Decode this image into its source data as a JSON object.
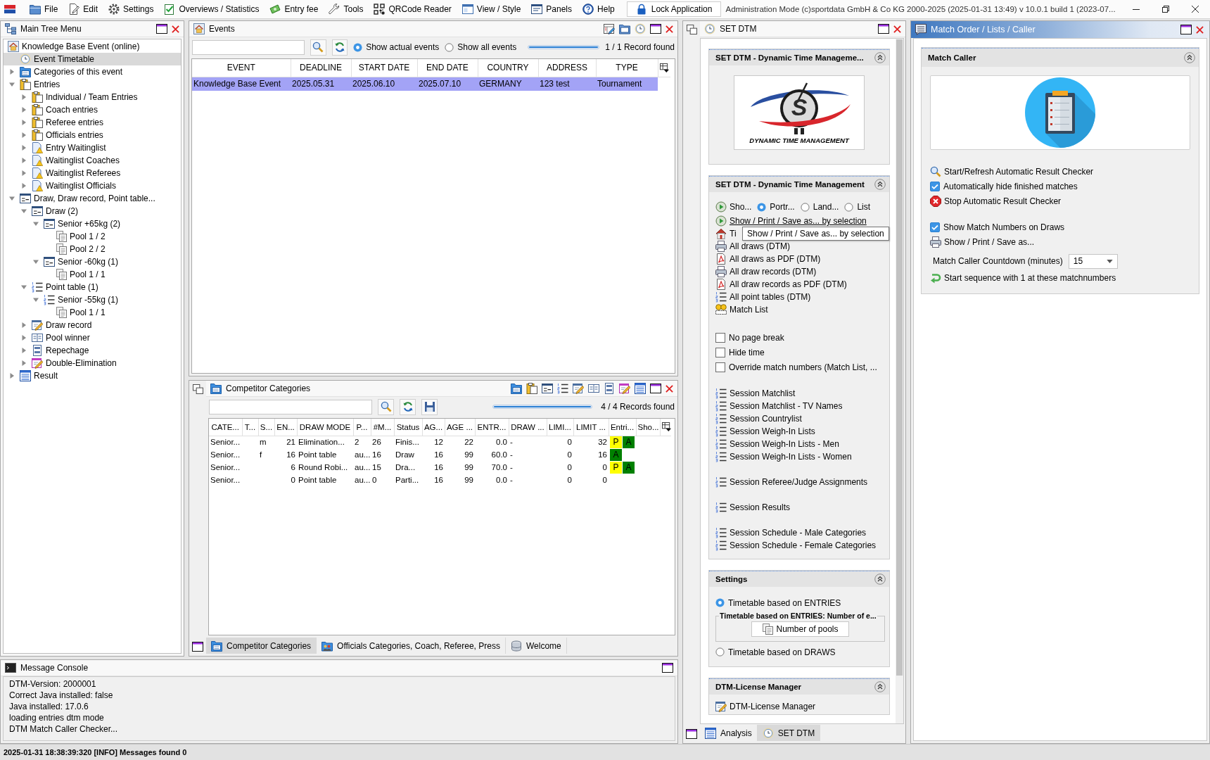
{
  "menu_bar": {
    "items": [
      "File",
      "Edit",
      "Settings",
      "Overviews / Statistics",
      "Entry fee",
      "Tools",
      "QRCode Reader",
      "View / Style",
      "Panels",
      "Help"
    ],
    "lock_button": "Lock Application",
    "title": "Administration Mode (c)sportdata GmbH & Co KG 2000-2025 (2025-01-31 13:49) v 10.0.1 build 1 (2023-07..."
  },
  "main_tree": {
    "title": "Main Tree Menu",
    "items": [
      {
        "label": "Knowledge Base Event (online)",
        "kind": "event",
        "selected": false,
        "children": [
          {
            "label": "Event Timetable",
            "kind": "timetable",
            "selected": true
          },
          {
            "label": "Categories of this event",
            "kind": "categories",
            "selected": false,
            "expanded": false
          },
          {
            "label": "Entries",
            "kind": "entries",
            "selected": false,
            "expanded": true,
            "children": [
              {
                "label": "Individual / Team Entries",
                "kind": "entries",
                "selected": false,
                "expanded": false
              },
              {
                "label": "Coach entries",
                "kind": "entries",
                "selected": false,
                "expanded": false
              },
              {
                "label": "Referee entries",
                "kind": "entries",
                "selected": false,
                "expanded": false
              },
              {
                "label": "Officials entries",
                "kind": "entries",
                "selected": false,
                "expanded": false
              },
              {
                "label": "Entry Waitinglist",
                "kind": "waitinglist",
                "selected": false,
                "expanded": false
              },
              {
                "label": "Waitinglist Coaches",
                "kind": "waitinglist",
                "selected": false,
                "expanded": false
              },
              {
                "label": "Waitinglist Referees",
                "kind": "waitinglist",
                "selected": false,
                "expanded": false
              },
              {
                "label": "Waitinglist Officials",
                "kind": "waitinglist",
                "selected": false,
                "expanded": false
              }
            ]
          },
          {
            "label": "Draw, Draw record, Point table...",
            "kind": "draw",
            "selected": false,
            "expanded": true,
            "children": [
              {
                "label": "Draw (2)",
                "kind": "draw",
                "selected": false,
                "expanded": true,
                "children": [
                  {
                    "label": "Senior +65kg (2)",
                    "kind": "draw",
                    "selected": false,
                    "expanded": true,
                    "children": [
                      {
                        "label": "Pool 1 / 2",
                        "kind": "pool",
                        "selected": false
                      },
                      {
                        "label": "Pool 2 / 2",
                        "kind": "pool",
                        "selected": false
                      }
                    ]
                  },
                  {
                    "label": "Senior -60kg (1)",
                    "kind": "draw",
                    "selected": false,
                    "expanded": true,
                    "children": [
                      {
                        "label": "Pool 1 / 1",
                        "kind": "pool",
                        "selected": false
                      }
                    ]
                  }
                ]
              },
              {
                "label": "Point table (1)",
                "kind": "point-table",
                "selected": false,
                "expanded": true,
                "children": [
                  {
                    "label": "Senior -55kg (1)",
                    "kind": "point-table",
                    "selected": false,
                    "expanded": true,
                    "children": [
                      {
                        "label": "Pool 1 / 1",
                        "kind": "pool",
                        "selected": false
                      }
                    ]
                  }
                ]
              },
              {
                "label": "Draw record",
                "kind": "draw-record",
                "selected": false,
                "expanded": false
              },
              {
                "label": "Pool winner",
                "kind": "pool-winner",
                "selected": false,
                "expanded": false
              },
              {
                "label": "Repechage",
                "kind": "repechage",
                "selected": false,
                "expanded": false
              },
              {
                "label": "Double-Elimination",
                "kind": "double-elimination",
                "selected": false,
                "expanded": false
              }
            ]
          },
          {
            "label": "Result",
            "kind": "result",
            "selected": false,
            "expanded": false
          }
        ]
      }
    ]
  },
  "events": {
    "title": "Events",
    "filters": [
      {
        "label": "Show actual events",
        "selected": true
      },
      {
        "label": "Show all events",
        "selected": false
      }
    ],
    "progress": {
      "level": 1
    },
    "record_count": "1 / 1 Record found",
    "table": {
      "columns": [
        "EVENT",
        "DEADLINE",
        "START DATE",
        "END DATE",
        "COUNTRY",
        "ADDRESS",
        "TYPE"
      ],
      "rows": [
        {
          "selected": true,
          "cells": [
            "Knowledge Base Event",
            "2025.05.31",
            "2025.06.10",
            "2025.07.10",
            "GERMANY",
            "123 test",
            "Tournament"
          ]
        }
      ]
    }
  },
  "competitor_categories": {
    "title": "Competitor Categories",
    "progress": {
      "level": 1
    },
    "record_count": "4 / 4 Records found",
    "table": {
      "columns": [
        "CATE...",
        "T...",
        "S...",
        "EN...",
        "DRAW MODE",
        "P...",
        "#M...",
        "Status",
        "AG...",
        "AGE ...",
        "ENTR...",
        "DRAW ...",
        "LIMI...",
        "LIMIT ...",
        "Entri...",
        "Sho..."
      ],
      "rows": [
        {
          "selected": false,
          "cells": [
            "Senior...",
            null,
            "m",
            "21",
            "Elimination...",
            "2",
            "26",
            "Finis...",
            "12",
            "22",
            "0.0",
            "-",
            "0",
            "32"
          ],
          "badges": [
            {
              "label": "P",
              "color": "#ffff00"
            },
            {
              "label": "A",
              "color": "#008000"
            }
          ]
        },
        {
          "selected": false,
          "cells": [
            "Senior...",
            null,
            "f",
            "16",
            "Point table",
            "au...",
            "16",
            "Draw",
            "16",
            "99",
            "60.0",
            "-",
            "0",
            "16"
          ],
          "badges": [
            {
              "label": "A",
              "color": "#008000"
            }
          ]
        },
        {
          "selected": false,
          "cells": [
            "Senior...",
            null,
            null,
            "6",
            "Round Robi...",
            "au...",
            "15",
            "Dra...",
            "16",
            "99",
            "70.0",
            "-",
            "0",
            "0"
          ],
          "badges": [
            {
              "label": "P",
              "color": "#ffff00"
            },
            {
              "label": "A",
              "color": "#008000"
            }
          ]
        },
        {
          "selected": false,
          "cells": [
            "Senior...",
            null,
            null,
            "0",
            "Point table",
            "au...",
            "0",
            "Parti...",
            "16",
            "99",
            "0.0",
            "-",
            "0",
            "0"
          ]
        }
      ]
    },
    "tabs": [
      {
        "label": "Competitor Categories",
        "selected": true
      },
      {
        "label": "Officials Categories, Coach, Referee, Press",
        "selected": false
      },
      {
        "label": "Welcome",
        "selected": false
      }
    ]
  },
  "message_console": {
    "title": "Message Console",
    "lines": [
      "DTM-Version: 2000001",
      "Correct Java installed: false",
      "Java installed: 17.0.6",
      "loading entries dtm mode",
      "DTM Match Caller Checker..."
    ]
  },
  "set_dtm": {
    "title": "SET DTM",
    "logo_section": {
      "title": "SET DTM - Dynamic Time Manageme...",
      "logo_letter": "S",
      "logo_text": "DYNAMIC TIME MANAGEMENT"
    },
    "print_section": {
      "title": "SET DTM - Dynamic Time Management",
      "show_button": "Sho...",
      "orientations": [
        {
          "label": "Portr...",
          "selected": true
        },
        {
          "label": "Land...",
          "selected": false
        },
        {
          "label": "List",
          "selected": false
        }
      ],
      "links": [
        {
          "kind": "show",
          "label": "Show / Print / Save as... by selection",
          "hovered": true
        },
        {
          "kind": "timetable",
          "label": "Ti",
          "hovered": false
        },
        {
          "kind": "print",
          "label": "All draws (DTM)",
          "hovered": false
        },
        {
          "kind": "pdf",
          "label": "All draws as PDF (DTM)",
          "hovered": false
        },
        {
          "kind": "print",
          "label": "All draw records (DTM)",
          "hovered": false
        },
        {
          "kind": "pdf",
          "label": "All draw records as PDF (DTM)",
          "hovered": false
        },
        {
          "kind": "list",
          "label": "All point tables (DTM)",
          "hovered": false
        },
        {
          "kind": "match",
          "label": "Match List",
          "hovered": false
        }
      ],
      "tooltip": "Show / Print / Save as... by selection",
      "options": [
        {
          "label": "No page break",
          "checked": false
        },
        {
          "label": "Hide time",
          "checked": false
        },
        {
          "label": "Override match numbers (Match List, ...",
          "checked": false
        }
      ],
      "session_groups": [
        [
          "Session Matchlist",
          "Session Matchlist - TV Names",
          "Session Countrylist",
          "Session Weigh-In Lists",
          "Session Weigh-In Lists - Men",
          "Session Weigh-In Lists - Women"
        ],
        [
          "Session Referee/Judge Assignments"
        ],
        [
          "Session Results"
        ],
        [
          "Session Schedule - Male Categories",
          "Session Schedule - Female Categories"
        ]
      ]
    },
    "settings_section": {
      "title": "Settings",
      "modes": [
        {
          "label": "Timetable based on ENTRIES",
          "selected": true
        },
        {
          "label": "Timetable based on DRAWS",
          "selected": false
        }
      ],
      "group_title": "Timetable based on ENTRIES: Number of e...",
      "pools_button": "Number of pools"
    },
    "license_section": {
      "title": "DTM-License Manager",
      "link": "DTM-License Manager"
    },
    "tabs": [
      {
        "label": "Analysis",
        "selected": false
      },
      {
        "label": "SET DTM",
        "selected": true
      }
    ]
  },
  "match_order": {
    "title": "Match Order / Lists / Caller",
    "section_title": "Match Caller",
    "action_groups": [
      [
        {
          "kind": "start",
          "label": "Start/Refresh Automatic Result Checker"
        },
        {
          "kind": "checkbox",
          "label": "Automatically hide finished matches",
          "checked": true
        },
        {
          "kind": "stop",
          "label": "Stop Automatic Result Checker"
        }
      ],
      [
        {
          "kind": "checkbox",
          "label": "Show Match Numbers on Draws",
          "checked": true
        },
        {
          "kind": "print",
          "label": "Show / Print / Save as..."
        }
      ]
    ],
    "countdown": {
      "label": "Match Caller Countdown (minutes)",
      "value": "15"
    },
    "sequence_link": "Start sequence with 1 at these matchnumbers"
  },
  "status_bar": "2025-01-31 18:38:39:320 [INFO] Messages found 0"
}
